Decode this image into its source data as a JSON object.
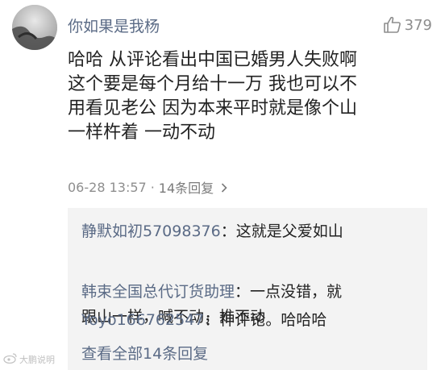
{
  "comment": {
    "username": "你如果是我杨",
    "like_count": "379",
    "text": "哈哈  从评论看出中国已婚男人失败啊\n这个要是每个月给十一万  我也可以不\n用看见老公   因为本来平时就是像个山\n一样杵着 一动不动",
    "timestamp": "06-28 13:57",
    "separator": "·",
    "reply_count_link": "14条回复"
  },
  "replies": [
    {
      "name": "静默如初57098376",
      "text": "：这就是父爱如山"
    },
    {
      "name": "韩束全国总代订货助理",
      "text": "：一点没错，就\n跟山一样，喊不动，推不动"
    },
    {
      "name": "Yoyo166762547",
      "text": "：神评论。哈哈哈"
    }
  ],
  "view_all_label": "查看全部14条回复",
  "watermark_text": "大鹏说明",
  "icons": {
    "like": "thumbs-up-icon",
    "chevron": "chevron-right-icon",
    "watermark": "weibo-logo-icon"
  },
  "colors": {
    "username": "#5b6b86",
    "body_text": "#222222",
    "meta_text": "#8e8e8e",
    "reply_background": "#f3f3f3"
  }
}
